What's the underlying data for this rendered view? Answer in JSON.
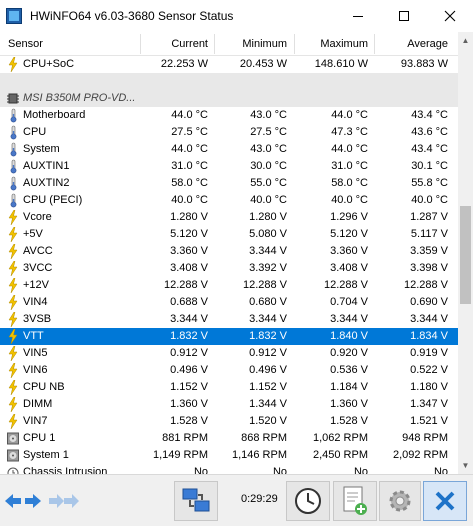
{
  "window": {
    "title": "HWiNFO64 v6.03-3680 Sensor Status",
    "minimize_glyph": "—",
    "maximize_glyph": "☐",
    "close_glyph": "✕"
  },
  "table": {
    "columns": [
      "Sensor",
      "Current",
      "Minimum",
      "Maximum",
      "Average"
    ],
    "rows": [
      {
        "kind": "data",
        "icon": "bolt-icon",
        "name": "CPU+SoC",
        "current": "22.253 W",
        "minimum": "20.453 W",
        "maximum": "148.610 W",
        "average": "93.883 W"
      },
      {
        "kind": "blank2"
      },
      {
        "kind": "group",
        "icon": "chip-icon",
        "name": "MSI B350M PRO-VD..."
      },
      {
        "kind": "data",
        "icon": "thermometer-icon",
        "name": "Motherboard",
        "current": "44.0 °C",
        "minimum": "43.0 °C",
        "maximum": "44.0 °C",
        "average": "43.4 °C"
      },
      {
        "kind": "data",
        "icon": "thermometer-icon",
        "name": "CPU",
        "current": "27.5 °C",
        "minimum": "27.5 °C",
        "maximum": "47.3 °C",
        "average": "43.6 °C"
      },
      {
        "kind": "data",
        "icon": "thermometer-icon",
        "name": "System",
        "current": "44.0 °C",
        "minimum": "43.0 °C",
        "maximum": "44.0 °C",
        "average": "43.4 °C"
      },
      {
        "kind": "data",
        "icon": "thermometer-icon",
        "name": "AUXTIN1",
        "current": "31.0 °C",
        "minimum": "30.0 °C",
        "maximum": "31.0 °C",
        "average": "30.1 °C"
      },
      {
        "kind": "data",
        "icon": "thermometer-icon",
        "name": "AUXTIN2",
        "current": "58.0 °C",
        "minimum": "55.0 °C",
        "maximum": "58.0 °C",
        "average": "55.8 °C"
      },
      {
        "kind": "data",
        "icon": "thermometer-icon",
        "name": "CPU (PECI)",
        "current": "40.0 °C",
        "minimum": "40.0 °C",
        "maximum": "40.0 °C",
        "average": "40.0 °C"
      },
      {
        "kind": "data",
        "icon": "bolt-icon",
        "name": "Vcore",
        "current": "1.280 V",
        "minimum": "1.280 V",
        "maximum": "1.296 V",
        "average": "1.287 V"
      },
      {
        "kind": "data",
        "icon": "bolt-icon",
        "name": "+5V",
        "current": "5.120 V",
        "minimum": "5.080 V",
        "maximum": "5.120 V",
        "average": "5.117 V"
      },
      {
        "kind": "data",
        "icon": "bolt-icon",
        "name": "AVCC",
        "current": "3.360 V",
        "minimum": "3.344 V",
        "maximum": "3.360 V",
        "average": "3.359 V"
      },
      {
        "kind": "data",
        "icon": "bolt-icon",
        "name": "3VCC",
        "current": "3.408 V",
        "minimum": "3.392 V",
        "maximum": "3.408 V",
        "average": "3.398 V"
      },
      {
        "kind": "data",
        "icon": "bolt-icon",
        "name": "+12V",
        "current": "12.288 V",
        "minimum": "12.288 V",
        "maximum": "12.288 V",
        "average": "12.288 V"
      },
      {
        "kind": "data",
        "icon": "bolt-icon",
        "name": "VIN4",
        "current": "0.688 V",
        "minimum": "0.680 V",
        "maximum": "0.704 V",
        "average": "0.690 V"
      },
      {
        "kind": "data",
        "icon": "bolt-icon",
        "name": "3VSB",
        "current": "3.344 V",
        "minimum": "3.344 V",
        "maximum": "3.344 V",
        "average": "3.344 V"
      },
      {
        "kind": "data",
        "icon": "bolt-icon",
        "name": "VTT",
        "current": "1.832 V",
        "minimum": "1.832 V",
        "maximum": "1.840 V",
        "average": "1.834 V",
        "selected": true
      },
      {
        "kind": "data",
        "icon": "bolt-icon",
        "name": "VIN5",
        "current": "0.912 V",
        "minimum": "0.912 V",
        "maximum": "0.920 V",
        "average": "0.919 V"
      },
      {
        "kind": "data",
        "icon": "bolt-icon",
        "name": "VIN6",
        "current": "0.496 V",
        "minimum": "0.496 V",
        "maximum": "0.536 V",
        "average": "0.522 V"
      },
      {
        "kind": "data",
        "icon": "bolt-icon",
        "name": "CPU NB",
        "current": "1.152 V",
        "minimum": "1.152 V",
        "maximum": "1.184 V",
        "average": "1.180 V"
      },
      {
        "kind": "data",
        "icon": "bolt-icon",
        "name": "DIMM",
        "current": "1.360 V",
        "minimum": "1.344 V",
        "maximum": "1.360 V",
        "average": "1.347 V"
      },
      {
        "kind": "data",
        "icon": "bolt-icon",
        "name": "VIN7",
        "current": "1.528 V",
        "minimum": "1.520 V",
        "maximum": "1.528 V",
        "average": "1.521 V"
      },
      {
        "kind": "data",
        "icon": "fan-icon",
        "name": "CPU 1",
        "current": "881 RPM",
        "minimum": "868 RPM",
        "maximum": "1,062 RPM",
        "average": "948 RPM"
      },
      {
        "kind": "data",
        "icon": "fan-icon",
        "name": "System 1",
        "current": "1,149 RPM",
        "minimum": "1,146 RPM",
        "maximum": "2,450 RPM",
        "average": "2,092 RPM"
      },
      {
        "kind": "data",
        "icon": "clock-small-icon",
        "name": "Chassis Intrusion",
        "current": "No",
        "minimum": "No",
        "maximum": "No",
        "average": "No"
      }
    ]
  },
  "toolbar": {
    "elapsed_time": "0:29:29",
    "buttons": [
      "nav-left-button",
      "nav-right-button",
      "network-button",
      "clock-button",
      "report-button",
      "settings-button",
      "close-button"
    ]
  },
  "colors": {
    "selection": "#0078d7",
    "group_bg": "#e8e8e8",
    "close_accent": "#1e73c8"
  }
}
